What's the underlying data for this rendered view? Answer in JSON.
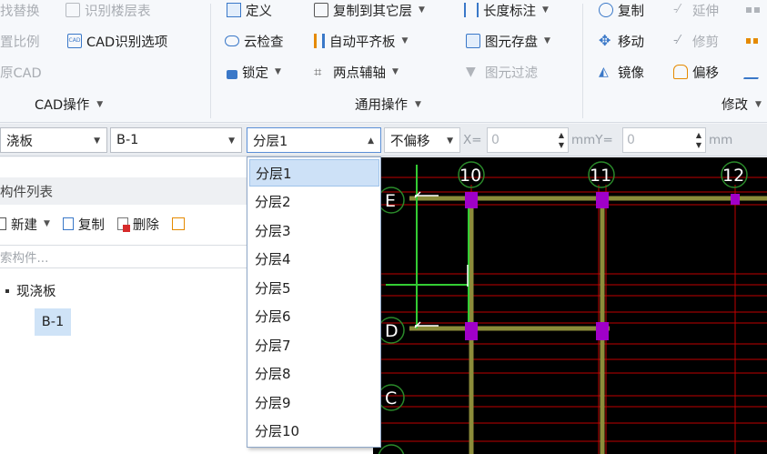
{
  "ribbon": {
    "cad_group": {
      "label": "CAD操作",
      "items": [
        {
          "label": "找替换",
          "disabled": true,
          "icon": "find-replace-icon"
        },
        {
          "label": "识别楼层表",
          "disabled": true,
          "icon": "floor-table-icon"
        },
        {
          "label": "置比例",
          "disabled": true,
          "icon": "scale-icon"
        },
        {
          "label": "CAD识别选项",
          "disabled": false,
          "icon": "cad-options-icon"
        },
        {
          "label": "原CAD",
          "disabled": true,
          "icon": "restore-cad-icon"
        }
      ]
    },
    "common_group": {
      "label": "通用操作",
      "items": [
        {
          "label": "定义",
          "icon": "define-icon",
          "caret": false
        },
        {
          "label": "复制到其它层",
          "icon": "copy-to-layer-icon",
          "caret": true
        },
        {
          "label": "长度标注",
          "icon": "length-dimension-icon",
          "caret": true
        },
        {
          "label": "云检查",
          "icon": "cloud-check-icon",
          "caret": false
        },
        {
          "label": "自动平齐板",
          "icon": "auto-align-slab-icon",
          "caret": true
        },
        {
          "label": "图元存盘",
          "icon": "element-save-icon",
          "caret": true
        },
        {
          "label": "锁定",
          "icon": "lock-icon",
          "caret": true
        },
        {
          "label": "两点辅轴",
          "icon": "two-point-axis-icon",
          "caret": true
        },
        {
          "label": "图元过滤",
          "icon": "filter-icon",
          "caret": false,
          "disabled": true
        }
      ]
    },
    "modify_group": {
      "label": "修改",
      "items": [
        {
          "label": "复制",
          "icon": "copy-icon",
          "disabled": false
        },
        {
          "label": "延伸",
          "icon": "extend-icon",
          "disabled": true
        },
        {
          "label": "移动",
          "icon": "move-icon",
          "disabled": false
        },
        {
          "label": "修剪",
          "icon": "trim-icon",
          "disabled": true
        },
        {
          "label": "镜像",
          "icon": "mirror-icon",
          "disabled": false
        },
        {
          "label": "偏移",
          "icon": "offset-icon",
          "disabled": false
        }
      ]
    }
  },
  "toolbar": {
    "component_type": "浇板",
    "component_name": "B-1",
    "layer": "分层1",
    "offset_mode": "不偏移",
    "x_label": "X=",
    "x_value": "0",
    "unit_mid": "mmY=",
    "y_value": "0",
    "unit_end": "mm"
  },
  "layer_dropdown": {
    "options": [
      "分层1",
      "分层2",
      "分层3",
      "分层4",
      "分层5",
      "分层6",
      "分层7",
      "分层8",
      "分层9",
      "分层10"
    ],
    "selected_index": 0
  },
  "component_panel": {
    "title": "构件列表",
    "new_label": "新建",
    "copy_label": "复制",
    "delete_label": "删除",
    "search_placeholder": "索构件...",
    "tree_root": "现浇板",
    "tree_child": "B-1"
  },
  "canvas": {
    "axis_numbers": [
      "10",
      "11",
      "12"
    ],
    "axis_letters": [
      "E",
      "D",
      "C"
    ],
    "colors": {
      "background": "#000000",
      "axis_line": "#cc0000",
      "beam": "#8c8c3a",
      "marker": "#a000c8",
      "green_line": "#33cc33",
      "bubble": "#2a8a2a"
    }
  }
}
